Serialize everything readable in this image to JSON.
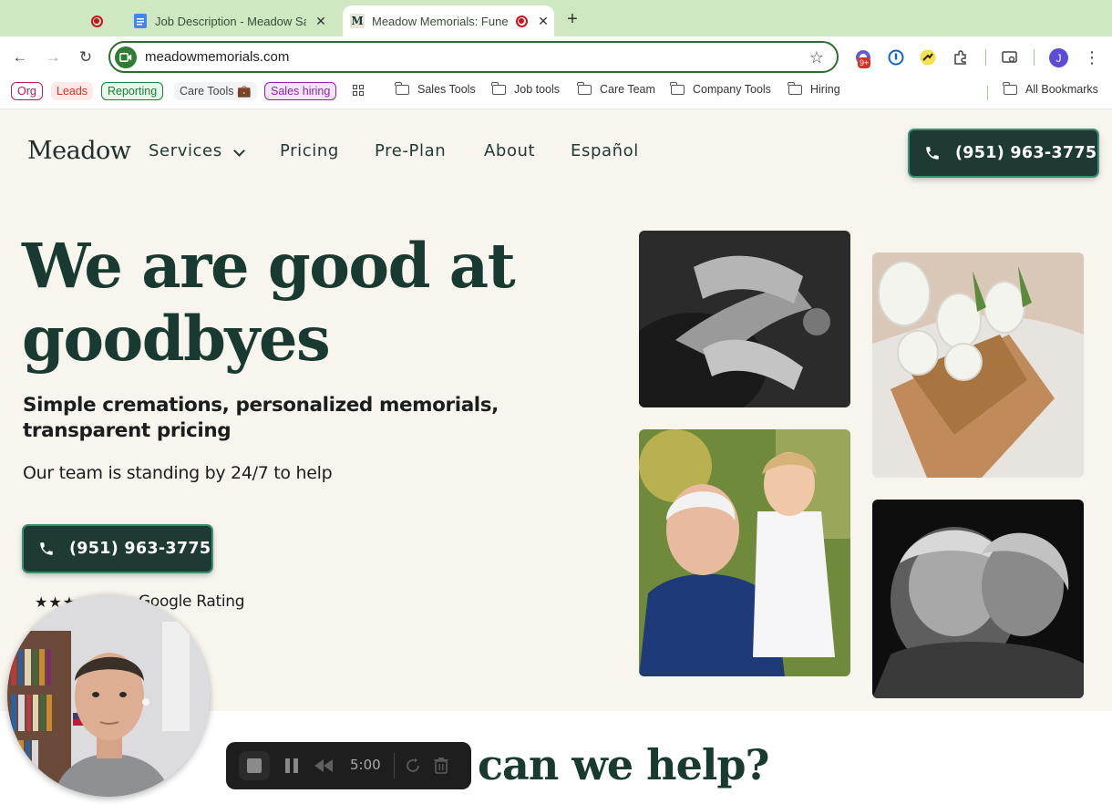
{
  "browser": {
    "tabs": [
      {
        "title": "",
        "state": "recording"
      },
      {
        "title": "Job Description - Meadow Sa",
        "favicon": "docs-icon"
      },
      {
        "title": "Meadow Memorials: Fune",
        "favicon": "meadow-m-icon",
        "active": true
      }
    ],
    "favicon_letter": "M",
    "url": "meadowmemorials.com",
    "extension_badge": "9+",
    "profile_initial": "J"
  },
  "bookmarks": {
    "chips": [
      {
        "label": "Org",
        "color": "#c2185b"
      },
      {
        "label": "Leads",
        "color": "#d93025"
      },
      {
        "label": "Reporting",
        "color": "#188038"
      },
      {
        "label": "Care Tools 💼",
        "color": "#5f6368"
      },
      {
        "label": "Sales hiring",
        "color": "#8e24aa"
      }
    ],
    "folders": [
      "Sales Tools",
      "Job tools",
      "Care Team",
      "Company Tools",
      "Hiring"
    ],
    "all_bookmarks": "All Bookmarks"
  },
  "site": {
    "logo": "Meadow",
    "nav": [
      "Services",
      "Pricing",
      "Pre-Plan",
      "About",
      "Español"
    ],
    "phone": "(951) 963-3775",
    "hero": {
      "title": "We are good at goodbyes",
      "subtitle": "Simple cremations, personalized memorials, transparent pricing",
      "note": "Our team is standing by 24/7 to help",
      "stars": "★★★",
      "rating_text": "Google Rating"
    },
    "section_title": "can we help?"
  },
  "recorder": {
    "time": "5:00"
  },
  "colors": {
    "brand_dark": "#1e3a34",
    "page_bg": "#f8f5ef",
    "tabstrip": "#cfe8c2"
  }
}
